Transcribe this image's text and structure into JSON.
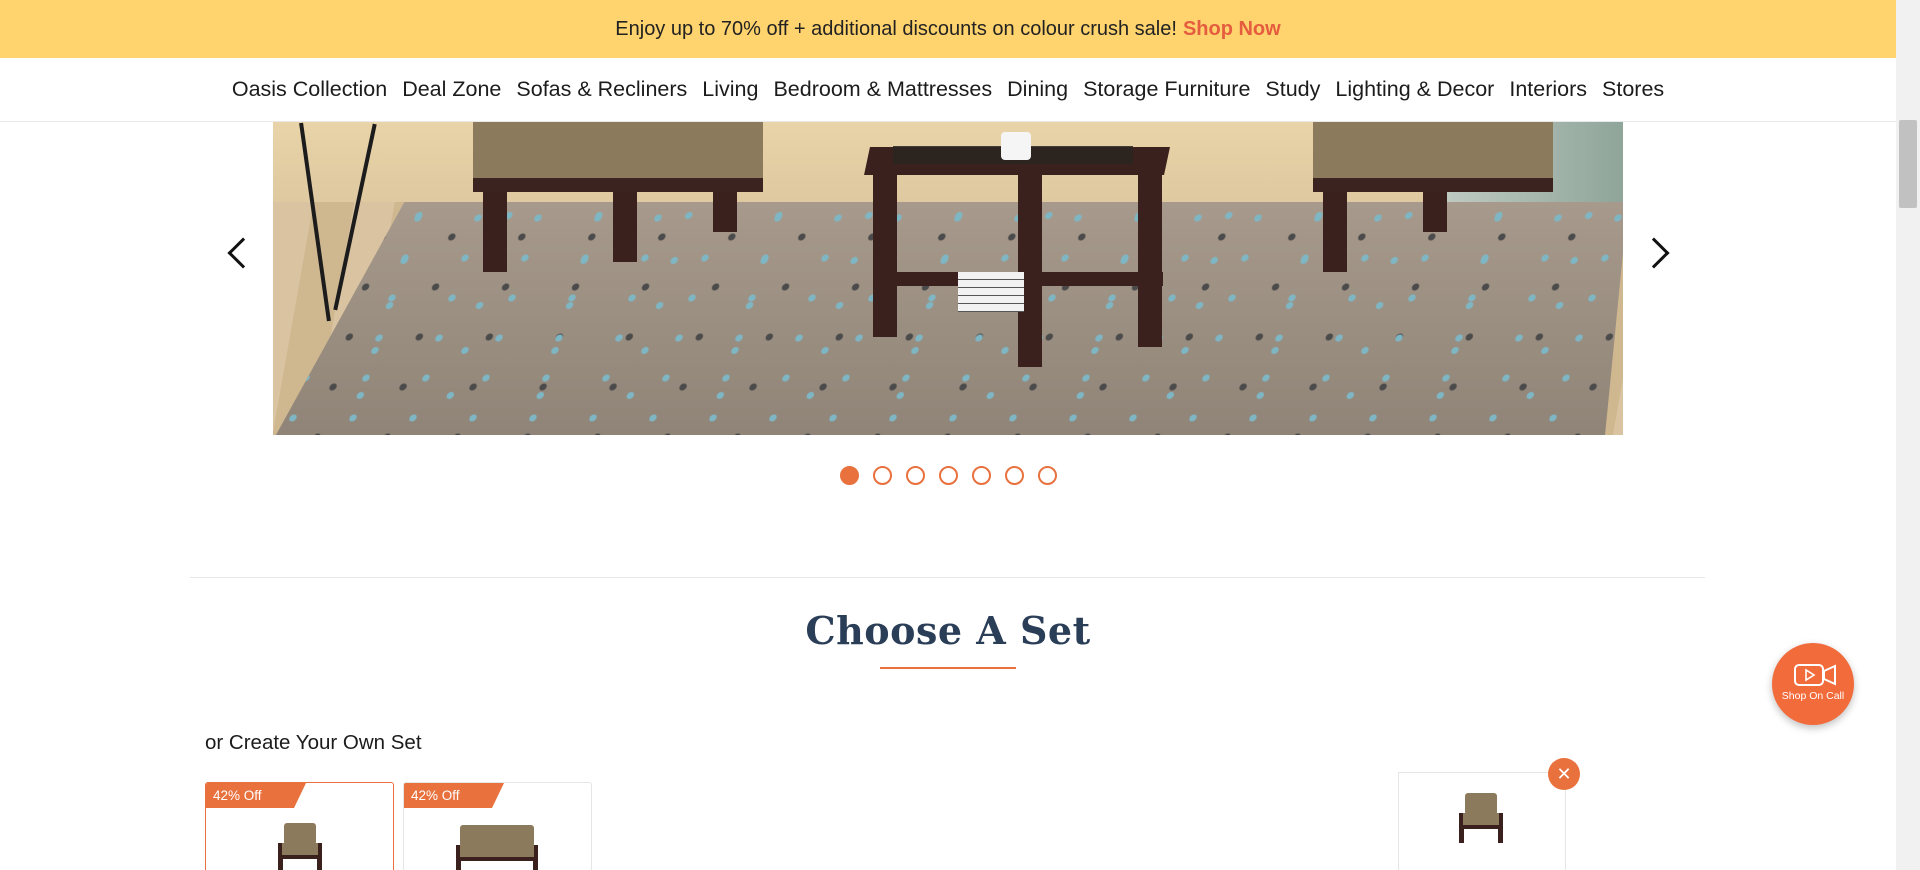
{
  "promo": {
    "text": "Enjoy up to 70% off + additional discounts on colour crush sale!",
    "link": "Shop Now"
  },
  "nav": {
    "items": [
      "Oasis Collection",
      "Deal Zone",
      "Sofas & Recliners",
      "Living",
      "Bedroom & Mattresses",
      "Dining",
      "Storage Furniture",
      "Study",
      "Lighting & Decor",
      "Interiors",
      "Stores"
    ]
  },
  "carousel": {
    "slides_total": 7,
    "active_index": 0
  },
  "section": {
    "title": "Choose A Set",
    "subtitle": "or Create Your Own Set"
  },
  "cards": [
    {
      "badge": "42% Off",
      "selected": true
    },
    {
      "badge": "42% Off",
      "selected": false
    }
  ],
  "remove_label": "✕",
  "shop_on_call": {
    "label": "Shop On Call"
  },
  "colors": {
    "accent": "#e8713e",
    "promo_bg": "#ffd36e",
    "title": "#2b3e58"
  }
}
